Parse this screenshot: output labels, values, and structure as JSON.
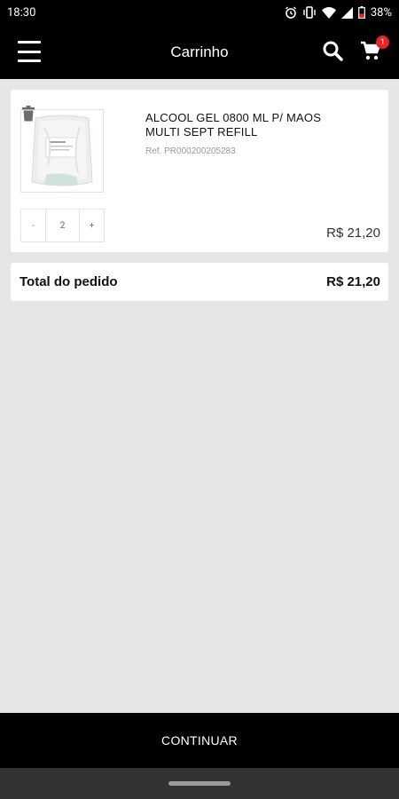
{
  "status_bar": {
    "time": "18:30",
    "battery": "38%",
    "icons": [
      "alarm-icon",
      "vibrate-icon",
      "wifi-icon",
      "signal-icon",
      "battery-icon"
    ]
  },
  "app_bar": {
    "title": "Carrinho",
    "cart_count": "1",
    "icons": [
      "menu-icon",
      "search-icon",
      "cart-icon"
    ]
  },
  "cart": {
    "items": [
      {
        "name": "ALCOOL GEL 0800 ML P/ MAOS MULTI SEPT REFILL",
        "ref": "Ref. PR000200205283",
        "quantity": "2",
        "minus_label": "-",
        "plus_label": "+",
        "price": "R$ 21,20"
      }
    ],
    "total_label": "Total do pedido",
    "total_value": "R$ 21,20"
  },
  "footer": {
    "continue_label": "CONTINUAR"
  },
  "colors": {
    "background": "#e6e6e6",
    "bar": "#000000",
    "badge": "#e3262b"
  }
}
